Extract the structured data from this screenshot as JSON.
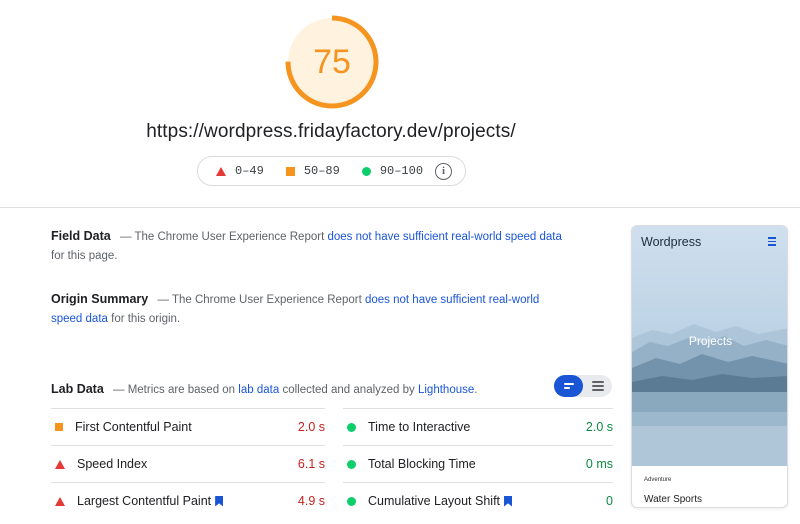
{
  "score": {
    "value": "75",
    "fraction": 0.75,
    "color": "#f5941f"
  },
  "url": "https://wordpress.fridayfactory.dev/projects/",
  "legend": {
    "items": [
      {
        "label": "0–49",
        "icon": "triangle-red"
      },
      {
        "label": "50–89",
        "icon": "square-orange"
      },
      {
        "label": "90–100",
        "icon": "circle-green"
      }
    ],
    "info_icon": "info-icon"
  },
  "field_data": {
    "heading": "Field Data",
    "text_before": "— The Chrome User Experience Report",
    "link": "does not have sufficient real-world speed data",
    "text_after": "for this page."
  },
  "origin_summary": {
    "heading": "Origin Summary",
    "text_before": "— The Chrome User Experience Report",
    "link": "does not have sufficient real-world speed data",
    "text_after": "for this origin."
  },
  "lab_data": {
    "heading": "Lab Data",
    "text_before": "— Metrics are based on",
    "link1": "lab data",
    "text_middle": "collected and analyzed by",
    "link2": "Lighthouse",
    "text_after": ".",
    "view_toggle": {
      "selected": "summary-view",
      "options": [
        "summary-view",
        "list-view"
      ]
    }
  },
  "metrics": {
    "left": [
      {
        "name": "First Contentful Paint",
        "value": "2.0 s",
        "status": "average"
      },
      {
        "name": "Speed Index",
        "value": "6.1 s",
        "status": "fail"
      },
      {
        "name": "Largest Contentful Paint",
        "value": "4.9 s",
        "status": "fail",
        "bookmark": true
      }
    ],
    "right": [
      {
        "name": "Time to Interactive",
        "value": "2.0 s",
        "status": "pass"
      },
      {
        "name": "Total Blocking Time",
        "value": "0 ms",
        "status": "pass"
      },
      {
        "name": "Cumulative Layout Shift",
        "value": "0",
        "status": "pass",
        "bookmark": true
      }
    ]
  },
  "screenshot": {
    "site_title": "Wordpress",
    "hero_title": "Projects",
    "tag": "Adventure",
    "subtitle": "Water Sports",
    "menu_icon": "hamburger-icon"
  },
  "colors": {
    "fail": "#e53935",
    "average": "#f5941f",
    "pass": "#0cce6b",
    "link": "#1a55d6"
  }
}
